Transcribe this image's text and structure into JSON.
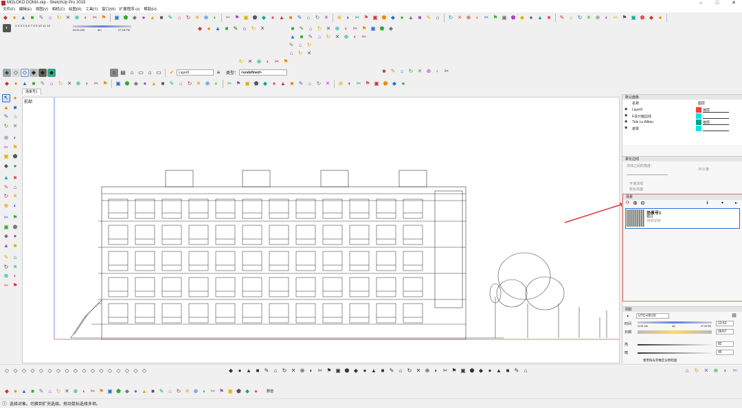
{
  "window": {
    "title": "MOLOKO DOMA.skp - SketchUp Pro 2019"
  },
  "menu": [
    "文件(F)",
    "编辑(E)",
    "视图(V)",
    "相机(C)",
    "绘图(R)",
    "工具(T)",
    "窗口(W)",
    "扩展程序 (x)",
    "帮助(H)"
  ],
  "shadow_bar": {
    "months": "1 2 3 4 5 6 7 8 9 10 11 12",
    "sunrise": "04:51 AM",
    "noon": "afo",
    "sunset": "07:28 PM"
  },
  "layer_bar": {
    "layer": "Layer0",
    "type_label": "类型：",
    "type_value": "<undefined>"
  },
  "scene_tab": "场景号1",
  "camera_label": "前部",
  "tray": {
    "layers": {
      "header": "默认面板",
      "columns": [
        "名称",
        "图层"
      ],
      "rows": [
        {
          "name": "Layer0",
          "tag": "按层",
          "color": "#ff3b3b"
        },
        {
          "name": "F设计面边线",
          "tag": "",
          "color": "#00e5e5"
        },
        {
          "name": "Tids Lu Allimu",
          "tag": "按层",
          "color": "#00a08a"
        },
        {
          "name": "遮罩",
          "tag": "",
          "color": "#00e5e5"
        }
      ]
    },
    "softedges": {
      "header": "柔化边线",
      "label": "法线之间的角度：",
      "value": "20.0 度",
      "opt1": "平滑法线",
      "opt2": "软化共面"
    },
    "scenes": {
      "header": "场景",
      "item_name": "场景号1",
      "item_sub": "预计",
      "item_note": "场景说明"
    },
    "shadows": {
      "header": "阴影",
      "tz": "UTC+08:00",
      "time_label": "时间",
      "date_label": "日期",
      "time_start": "04:51 AM",
      "time_mid": "afo",
      "time_end": "07:28 PM",
      "time_value": "13:52",
      "date_value": "06/07",
      "light_label": "亮",
      "dark_label": "暗",
      "light_value": "82",
      "dark_value": "45",
      "sun_option": "使用阳光参数区分明暗面"
    }
  },
  "status": {
    "text": "选择对象。切换到扩充选择。拖动鼠标选择多项。",
    "measurement_label": "数值"
  },
  "colors": {
    "accent": "#2a6fd6",
    "highlight_red": "#e03030"
  }
}
